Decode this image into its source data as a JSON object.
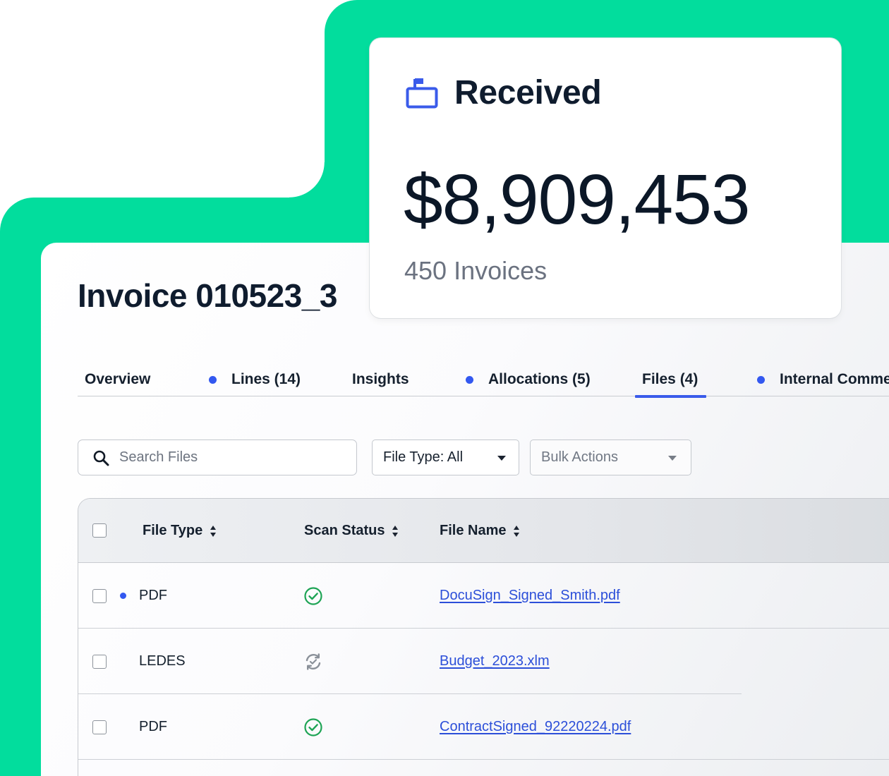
{
  "invoice": {
    "title": "Invoice 010523_3"
  },
  "tabs": [
    {
      "label": "Overview",
      "dot": false,
      "active": false
    },
    {
      "label": "Lines (14)",
      "dot": true,
      "active": false
    },
    {
      "label": "Insights",
      "dot": false,
      "active": false
    },
    {
      "label": "Allocations (5)",
      "dot": true,
      "active": false
    },
    {
      "label": "Files (4)",
      "dot": false,
      "active": true
    },
    {
      "label": "Internal Comme",
      "dot": true,
      "active": false
    }
  ],
  "search": {
    "placeholder": "Search Files"
  },
  "filters": {
    "file_type": "File Type: All",
    "bulk_actions": "Bulk Actions"
  },
  "table": {
    "headers": {
      "file_type": "File Type",
      "scan_status": "Scan Status",
      "file_name": "File Name"
    },
    "rows": [
      {
        "file_type": "PDF",
        "scan_status": "check-circle-icon",
        "file_name": "DocuSign_Signed_Smith.pdf",
        "unread": true
      },
      {
        "file_type": "LEDES",
        "scan_status": "scanning-icon",
        "file_name": "Budget_2023.xlm",
        "unread": false
      },
      {
        "file_type": "PDF",
        "scan_status": "check-circle-icon",
        "file_name": "ContractSigned_92220224.pdf",
        "unread": false
      }
    ]
  },
  "card": {
    "icon": "received-box-icon",
    "label": "Received",
    "amount": "$8,909,453",
    "subtitle": "450 Invoices"
  },
  "colors": {
    "brand_green": "#02dd9d",
    "accent_blue": "#3358f0",
    "link_blue": "#2c4fd9",
    "success_green": "#1ea455",
    "text_dark": "#0f1c2e"
  }
}
